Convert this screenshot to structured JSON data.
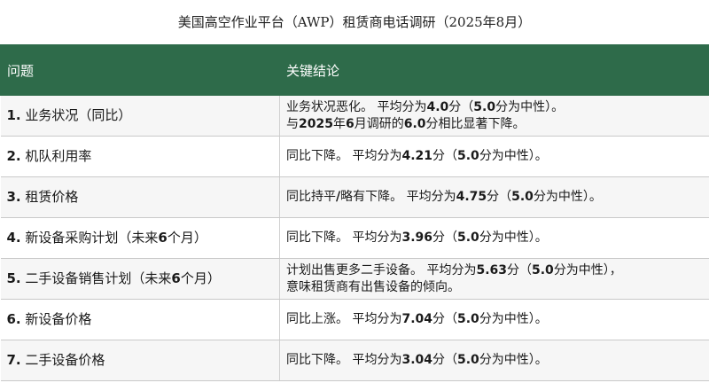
{
  "title": "美国高空作业平台（AWP）租赁商电话调研（2025年8月）",
  "header": {
    "col_question": "问题",
    "col_conclusion": "关键结论"
  },
  "rows": [
    {
      "num": "1.",
      "question": "业务状况（同比）",
      "lines": [
        [
          "业务状况恶化。 平均分为",
          "4.0",
          "分（",
          "5.0",
          "分为中性）。"
        ],
        [
          "与",
          "2025",
          "年",
          "6",
          "月调研的",
          "6.0",
          "分相比显著下降。"
        ]
      ]
    },
    {
      "num": "2.",
      "question": "机队利用率",
      "lines": [
        [
          "同比下降。 平均分为",
          "4.21",
          "分（",
          "5.0",
          "分为中性）。"
        ]
      ]
    },
    {
      "num": "3.",
      "question": "租赁价格",
      "lines": [
        [
          "同比持平",
          "/",
          "略有下降。 平均分为",
          "4.75",
          "分（",
          "5.0",
          "分为中性）。"
        ]
      ]
    },
    {
      "num": "4.",
      "question": "新设备采购计划（未来",
      "q_bold": "6",
      "q_tail": "个月）",
      "lines": [
        [
          "同比下降。 平均分为",
          "3.96",
          "分（",
          "5.0",
          "分为中性）。"
        ]
      ]
    },
    {
      "num": "5.",
      "question": "二手设备销售计划（未来",
      "q_bold": "6",
      "q_tail": "个月）",
      "lines": [
        [
          "计划出售更多二手设备。 平均分为",
          "5.63",
          "分（",
          "5.0",
          "分为中性），"
        ],
        [
          "意味租赁商有出售设备的倾向。"
        ]
      ]
    },
    {
      "num": "6.",
      "question": "新设备价格",
      "lines": [
        [
          "同比上涨。 平均分为",
          "7.04",
          "分（",
          "5.0",
          "分为中性）。"
        ]
      ]
    },
    {
      "num": "7.",
      "question": "二手设备价格",
      "lines": [
        [
          "同比下降。 平均分为",
          "3.04",
          "分（",
          "5.0",
          "分为中性）。"
        ]
      ]
    }
  ]
}
